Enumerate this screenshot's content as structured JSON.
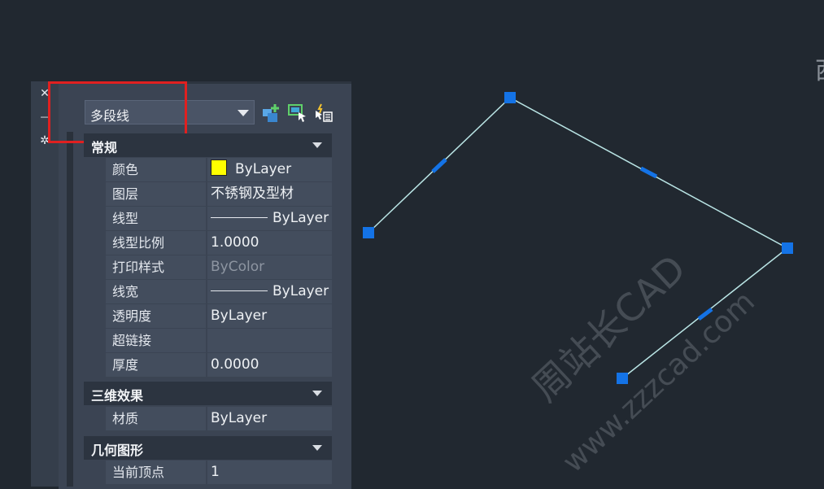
{
  "palette": {
    "object_type": "多段线",
    "sections": [
      {
        "title": "常规"
      },
      {
        "title": "三维效果"
      },
      {
        "title": "几何图形"
      }
    ],
    "general": {
      "color": {
        "key": "颜色",
        "value": "ByLayer",
        "swatch": "#ffff00"
      },
      "layer": {
        "key": "图层",
        "value": "不锈钢及型材"
      },
      "linetype": {
        "key": "线型",
        "value": "ByLayer"
      },
      "linetype_scale": {
        "key": "线型比例",
        "value": "1.0000"
      },
      "plot_style": {
        "key": "打印样式",
        "value": "ByColor"
      },
      "lineweight": {
        "key": "线宽",
        "value": "ByLayer"
      },
      "transparency": {
        "key": "透明度",
        "value": "ByLayer"
      },
      "hyperlink": {
        "key": "超链接",
        "value": ""
      },
      "thickness": {
        "key": "厚度",
        "value": "0.0000"
      }
    },
    "effects3d": {
      "material": {
        "key": "材质",
        "value": "ByLayer"
      }
    },
    "geometry": {
      "current_vertex": {
        "key": "当前顶点",
        "value": "1"
      }
    }
  },
  "watermark": {
    "main": "周站长CAD",
    "sub": "www.zzzcad.com"
  },
  "corner_text": "西",
  "colors": {
    "grip": "#1473e6",
    "polyline": "#b9e4e4",
    "highlight": "#e02020"
  },
  "icons": [
    "close-icon",
    "pin-icon",
    "settings-icon",
    "quick-select-icon",
    "select-objects-icon",
    "toggle-pickadd-icon"
  ]
}
